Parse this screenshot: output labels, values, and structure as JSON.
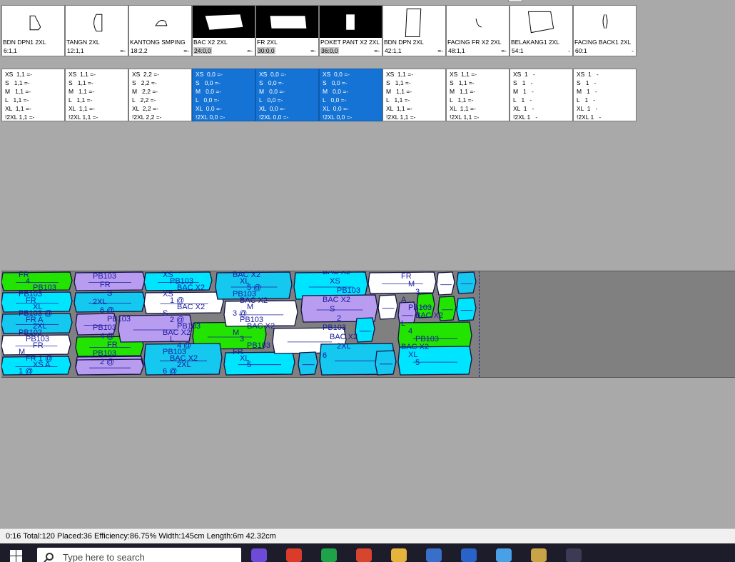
{
  "pieces": [
    {
      "name": "BDN DPN1 2XL",
      "stat": "6:1,1",
      "mark": "",
      "dark": false,
      "shape": "bdn1"
    },
    {
      "name": "TANGN 2XL",
      "stat": "12:1,1",
      "mark": "=-",
      "dark": false,
      "shape": "tangn"
    },
    {
      "name": "KANTONG SMPING",
      "stat": "18:2,2",
      "mark": "=-",
      "dark": false,
      "shape": "kantong"
    },
    {
      "name": "BAC X2 2XL",
      "stat": "24:0,0",
      "mark": "=-",
      "dark": true,
      "shape": "bac"
    },
    {
      "name": "FR 2XL",
      "stat": "30:0,0",
      "mark": "=-",
      "dark": true,
      "shape": "fr"
    },
    {
      "name": "POKET PANT X2 2XL",
      "stat": "36:0,0",
      "mark": "=-",
      "dark": true,
      "shape": "poket"
    },
    {
      "name": "BDN DPN 2XL",
      "stat": "42:1,1",
      "mark": "=-",
      "dark": false,
      "shape": "bdn"
    },
    {
      "name": "FACING  FR X2 2XL",
      "stat": "48:1,1",
      "mark": "=-",
      "dark": false,
      "shape": "facing"
    },
    {
      "name": "BELAKANG1 2XL",
      "stat": "54:1",
      "mark": "-",
      "dark": false,
      "shape": "belakang"
    },
    {
      "name": "FACING BACK1 2XL",
      "stat": "60:1",
      "mark": "-",
      "dark": false,
      "shape": "facingback"
    }
  ],
  "quantities": [
    {
      "selected": false,
      "lines": [
        "XS  1,1 =-",
        "S   1,1 =-",
        "M   1,1 =-",
        "L   1,1 =-",
        "XL  1,1 =-",
        "!2XL 1,1 =-"
      ]
    },
    {
      "selected": false,
      "lines": [
        "XS  1,1 =-",
        "S   1,1 =-",
        "M   1,1 =-",
        "L   1,1 =-",
        "XL  1,1 =-",
        "!2XL 1,1 =-"
      ]
    },
    {
      "selected": false,
      "lines": [
        "XS  2,2 =-",
        "S   2,2 =-",
        "M   2,2 =-",
        "L   2,2 =-",
        "XL  2,2 =-",
        "!2XL 2,2 =-"
      ]
    },
    {
      "selected": true,
      "lines": [
        "XS  0,0 =-",
        "S   0,0 =-",
        "M   0,0 =-",
        "L   0,0 =-",
        "XL  0,0 =-",
        "!2XL 0,0 =-"
      ]
    },
    {
      "selected": true,
      "lines": [
        "XS  0,0 =-",
        "S   0,0 =-",
        "M   0,0 =-",
        "L   0,0 =-",
        "XL  0,0 =-",
        "!2XL 0,0 =-"
      ]
    },
    {
      "selected": true,
      "lines": [
        "XS  0,0 =-",
        "S   0,0 =-",
        "M   0,0 =-",
        "L   0,0 =-",
        "XL  0,0 =-",
        "!2XL 0,0 =-"
      ]
    },
    {
      "selected": false,
      "lines": [
        "XS  1,1 =-",
        "S   1,1 =-",
        "M   1,1 =-",
        "L   1,1 =-",
        "XL  1,1 =-",
        "!2XL 1,1 =-"
      ]
    },
    {
      "selected": false,
      "lines": [
        "XS  1,1 =-",
        "S   1,1 =-",
        "M   1,1 =-",
        "L   1,1 =-",
        "XL  1,1 =-",
        "!2XL 1,1 =-"
      ]
    },
    {
      "selected": false,
      "lines": [
        "XS  1   -",
        "S   1   -",
        "M   1   -",
        "L   1   -",
        "XL  1   -",
        "!2XL 1   -"
      ]
    },
    {
      "selected": false,
      "lines": [
        "XS  1   -",
        "S   1   -",
        "M   1   -",
        "L   1   -",
        "XL  1   -",
        "!2XL 1   -"
      ]
    }
  ],
  "marker_labels": [
    [
      "FR",
      "4",
      "PB103",
      "PB103",
      "FR",
      "XL",
      "PB103 @",
      "FR A",
      "2XL",
      "PB102",
      "PB103",
      "FR",
      "M",
      "FR 1 @",
      "XS A",
      "1 @"
    ],
    [
      "PB103",
      "FR",
      "S",
      "2XL",
      "6 @",
      "PB103",
      "PB103",
      "4 @",
      "FR",
      "PB103",
      "2 @"
    ],
    [
      "XS",
      "PB103",
      "BAC X2",
      "XS",
      "1 @",
      "BAC X2",
      "S",
      "2 @",
      "PB103",
      "BAC X2",
      "L",
      "4 @",
      "PB103",
      "BAC X2",
      "2XL",
      "6 @"
    ],
    [
      "BAC X2",
      "XL",
      "5 @",
      "PB103",
      "BAC X2",
      "M",
      "3 @",
      "PB103",
      "BAC X2",
      "M",
      "3",
      "PB103",
      "FR",
      "XL",
      "5"
    ],
    [
      "BAC X2",
      "XS",
      "PB103",
      "BAC X2",
      "S",
      "2",
      "PB103",
      "BAC X2",
      "2XL",
      "6"
    ],
    [
      "FR",
      "M",
      "3",
      "A",
      "PB103",
      "BAC X2",
      "L",
      "4",
      "PB103",
      "BAC X2",
      "XL",
      "5"
    ]
  ],
  "status": {
    "time": "0:16",
    "total": "Total:120",
    "placed": "Placed:36",
    "efficiency": "Efficiency:86.75%",
    "width": "Width:145cm",
    "length": "Length:6m 42.32cm"
  },
  "taskbar": {
    "search_placeholder": "Type here to search",
    "apps": [
      "copilot-icon",
      "chrome-icon",
      "edge-icon",
      "app-icon-fish",
      "file-explorer-icon",
      "calculator-icon",
      "font-app-icon",
      "paint-app-icon",
      "bug-app-icon",
      "gear-app-icon"
    ]
  },
  "colors": {
    "selected_blue": "#1473d4",
    "piece_cyan": "#00e5ff",
    "piece_green": "#22e400",
    "piece_purple": "#b79cf0",
    "piece_sky": "#15c8ef",
    "piece_white": "#ffffff",
    "marker_bg": "#808080",
    "label_navy": "#1a1aa0"
  }
}
